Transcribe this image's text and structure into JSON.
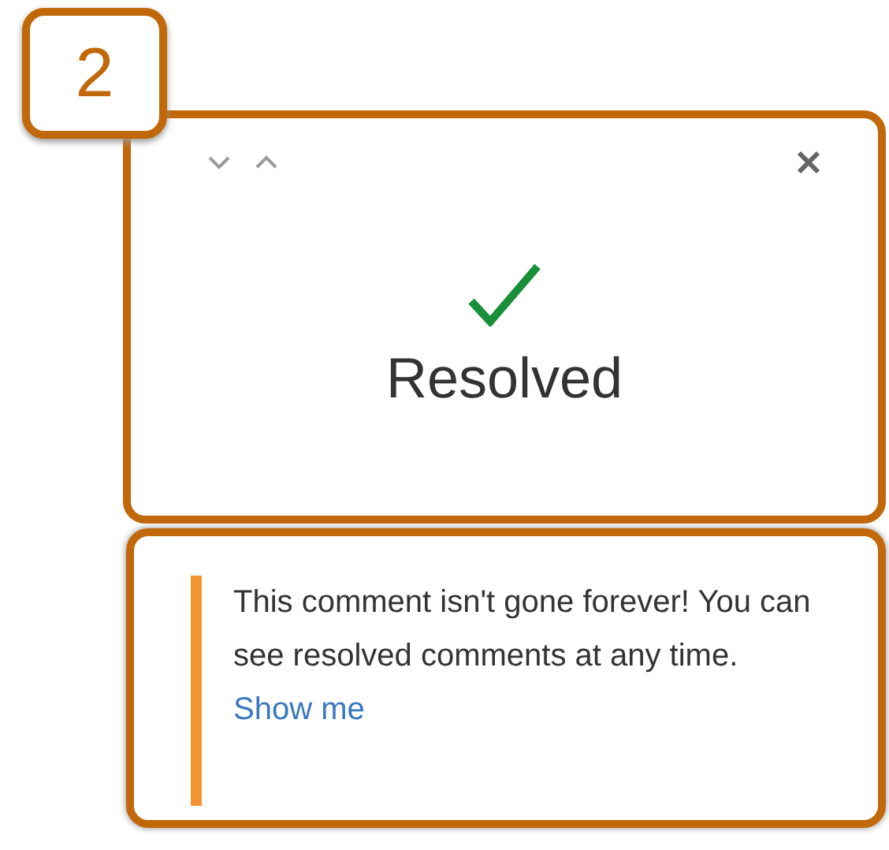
{
  "callout": {
    "number": "2"
  },
  "resolved_card": {
    "status": "Resolved"
  },
  "note": {
    "message": "This comment isn't gone forever! You can see resolved comments at any time.",
    "link": "Show me"
  }
}
